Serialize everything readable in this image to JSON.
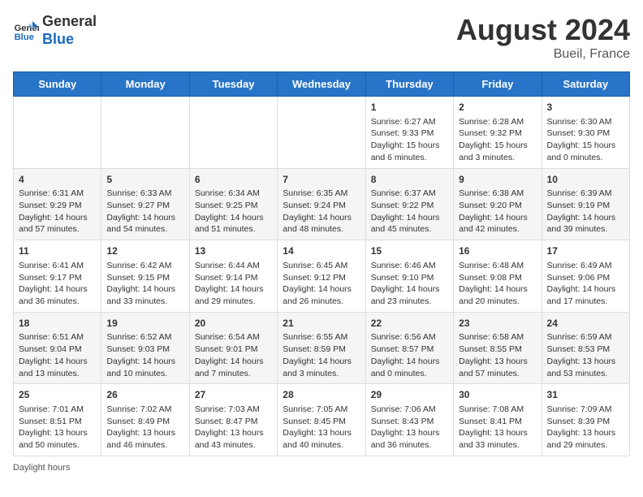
{
  "header": {
    "logo_line1": "General",
    "logo_line2": "Blue",
    "month_year": "August 2024",
    "location": "Bueil, France"
  },
  "days_of_week": [
    "Sunday",
    "Monday",
    "Tuesday",
    "Wednesday",
    "Thursday",
    "Friday",
    "Saturday"
  ],
  "footer": {
    "daylight_label": "Daylight hours"
  },
  "weeks": [
    [
      {
        "day": "",
        "info": ""
      },
      {
        "day": "",
        "info": ""
      },
      {
        "day": "",
        "info": ""
      },
      {
        "day": "",
        "info": ""
      },
      {
        "day": "1",
        "info": "Sunrise: 6:27 AM\nSunset: 9:33 PM\nDaylight: 15 hours and 6 minutes."
      },
      {
        "day": "2",
        "info": "Sunrise: 6:28 AM\nSunset: 9:32 PM\nDaylight: 15 hours and 3 minutes."
      },
      {
        "day": "3",
        "info": "Sunrise: 6:30 AM\nSunset: 9:30 PM\nDaylight: 15 hours and 0 minutes."
      }
    ],
    [
      {
        "day": "4",
        "info": "Sunrise: 6:31 AM\nSunset: 9:29 PM\nDaylight: 14 hours and 57 minutes."
      },
      {
        "day": "5",
        "info": "Sunrise: 6:33 AM\nSunset: 9:27 PM\nDaylight: 14 hours and 54 minutes."
      },
      {
        "day": "6",
        "info": "Sunrise: 6:34 AM\nSunset: 9:25 PM\nDaylight: 14 hours and 51 minutes."
      },
      {
        "day": "7",
        "info": "Sunrise: 6:35 AM\nSunset: 9:24 PM\nDaylight: 14 hours and 48 minutes."
      },
      {
        "day": "8",
        "info": "Sunrise: 6:37 AM\nSunset: 9:22 PM\nDaylight: 14 hours and 45 minutes."
      },
      {
        "day": "9",
        "info": "Sunrise: 6:38 AM\nSunset: 9:20 PM\nDaylight: 14 hours and 42 minutes."
      },
      {
        "day": "10",
        "info": "Sunrise: 6:39 AM\nSunset: 9:19 PM\nDaylight: 14 hours and 39 minutes."
      }
    ],
    [
      {
        "day": "11",
        "info": "Sunrise: 6:41 AM\nSunset: 9:17 PM\nDaylight: 14 hours and 36 minutes."
      },
      {
        "day": "12",
        "info": "Sunrise: 6:42 AM\nSunset: 9:15 PM\nDaylight: 14 hours and 33 minutes."
      },
      {
        "day": "13",
        "info": "Sunrise: 6:44 AM\nSunset: 9:14 PM\nDaylight: 14 hours and 29 minutes."
      },
      {
        "day": "14",
        "info": "Sunrise: 6:45 AM\nSunset: 9:12 PM\nDaylight: 14 hours and 26 minutes."
      },
      {
        "day": "15",
        "info": "Sunrise: 6:46 AM\nSunset: 9:10 PM\nDaylight: 14 hours and 23 minutes."
      },
      {
        "day": "16",
        "info": "Sunrise: 6:48 AM\nSunset: 9:08 PM\nDaylight: 14 hours and 20 minutes."
      },
      {
        "day": "17",
        "info": "Sunrise: 6:49 AM\nSunset: 9:06 PM\nDaylight: 14 hours and 17 minutes."
      }
    ],
    [
      {
        "day": "18",
        "info": "Sunrise: 6:51 AM\nSunset: 9:04 PM\nDaylight: 14 hours and 13 minutes."
      },
      {
        "day": "19",
        "info": "Sunrise: 6:52 AM\nSunset: 9:03 PM\nDaylight: 14 hours and 10 minutes."
      },
      {
        "day": "20",
        "info": "Sunrise: 6:54 AM\nSunset: 9:01 PM\nDaylight: 14 hours and 7 minutes."
      },
      {
        "day": "21",
        "info": "Sunrise: 6:55 AM\nSunset: 8:59 PM\nDaylight: 14 hours and 3 minutes."
      },
      {
        "day": "22",
        "info": "Sunrise: 6:56 AM\nSunset: 8:57 PM\nDaylight: 14 hours and 0 minutes."
      },
      {
        "day": "23",
        "info": "Sunrise: 6:58 AM\nSunset: 8:55 PM\nDaylight: 13 hours and 57 minutes."
      },
      {
        "day": "24",
        "info": "Sunrise: 6:59 AM\nSunset: 8:53 PM\nDaylight: 13 hours and 53 minutes."
      }
    ],
    [
      {
        "day": "25",
        "info": "Sunrise: 7:01 AM\nSunset: 8:51 PM\nDaylight: 13 hours and 50 minutes."
      },
      {
        "day": "26",
        "info": "Sunrise: 7:02 AM\nSunset: 8:49 PM\nDaylight: 13 hours and 46 minutes."
      },
      {
        "day": "27",
        "info": "Sunrise: 7:03 AM\nSunset: 8:47 PM\nDaylight: 13 hours and 43 minutes."
      },
      {
        "day": "28",
        "info": "Sunrise: 7:05 AM\nSunset: 8:45 PM\nDaylight: 13 hours and 40 minutes."
      },
      {
        "day": "29",
        "info": "Sunrise: 7:06 AM\nSunset: 8:43 PM\nDaylight: 13 hours and 36 minutes."
      },
      {
        "day": "30",
        "info": "Sunrise: 7:08 AM\nSunset: 8:41 PM\nDaylight: 13 hours and 33 minutes."
      },
      {
        "day": "31",
        "info": "Sunrise: 7:09 AM\nSunset: 8:39 PM\nDaylight: 13 hours and 29 minutes."
      }
    ]
  ]
}
